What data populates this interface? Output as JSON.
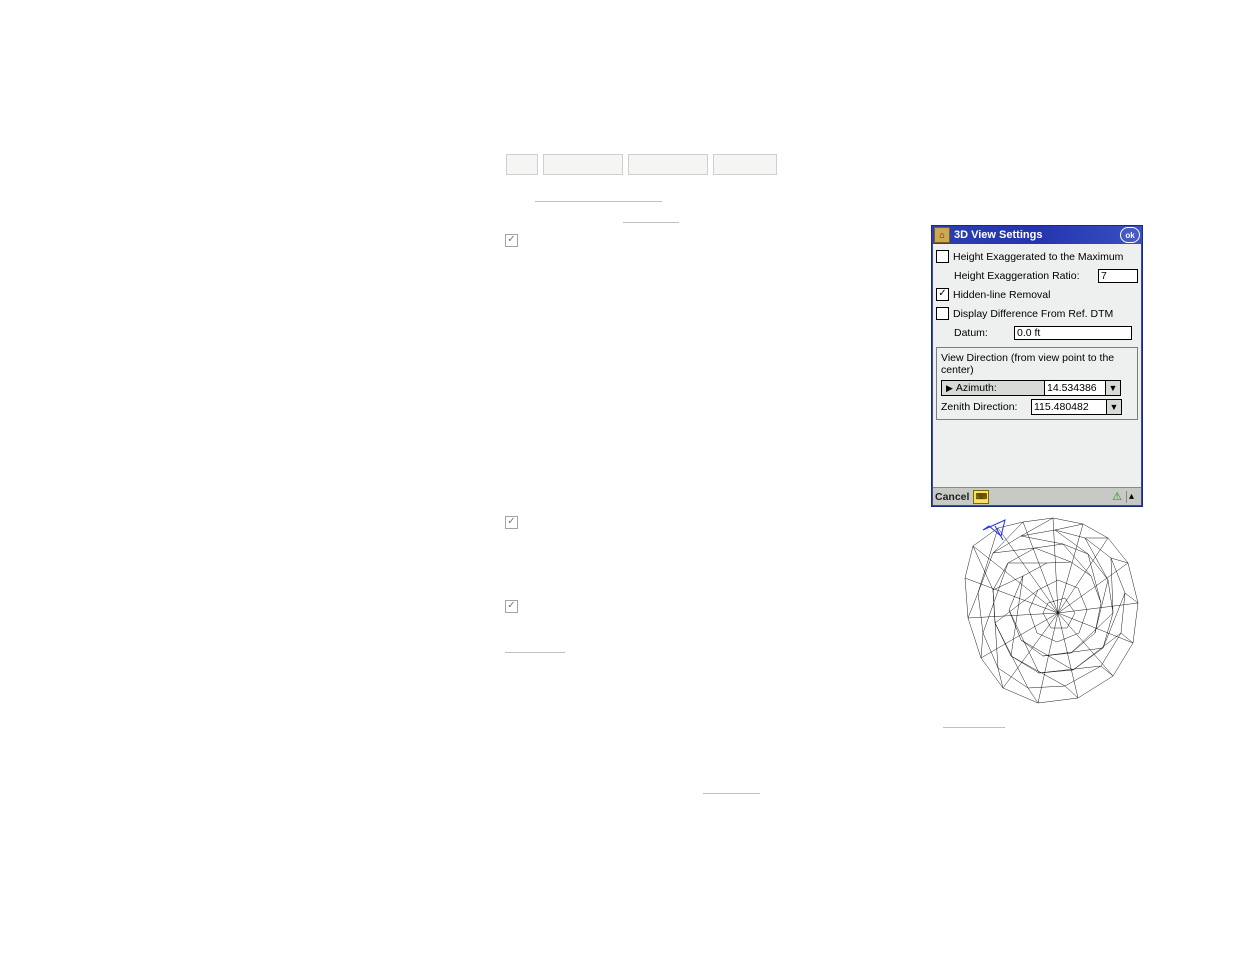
{
  "dialog": {
    "title": "3D View Settings",
    "ok": "ok",
    "height_exagg_max": {
      "checked": false,
      "label": "Height Exaggerated to the Maximum"
    },
    "height_ratio_label": "Height Exaggeration Ratio:",
    "height_ratio_value": "7",
    "hidden_line": {
      "checked": true,
      "label": "Hidden-line Removal"
    },
    "display_diff": {
      "checked": false,
      "label": "Display Difference From Ref. DTM"
    },
    "datum_label": "Datum:",
    "datum_value": "0.0 ft",
    "view_direction_label": "View Direction (from view point to the center)",
    "azimuth_label": "Azimuth:",
    "azimuth_value": "14.534386",
    "zenith_label": "Zenith Direction:",
    "zenith_value": "115.480482",
    "cancel": "Cancel"
  }
}
